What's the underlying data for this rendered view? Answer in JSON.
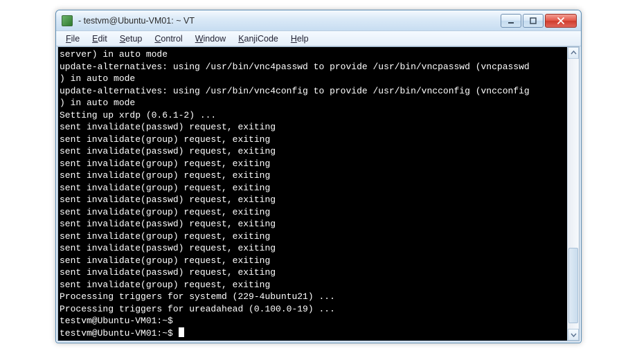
{
  "window": {
    "title": " - testvm@Ubuntu-VM01: ~ VT"
  },
  "menu": {
    "items": [
      {
        "u": "F",
        "rest": "ile"
      },
      {
        "u": "E",
        "rest": "dit"
      },
      {
        "u": "S",
        "rest": "etup"
      },
      {
        "u": "C",
        "rest": "ontrol"
      },
      {
        "u": "W",
        "rest": "indow"
      },
      {
        "u": "K",
        "rest": "anjiCode"
      },
      {
        "u": "H",
        "rest": "elp"
      }
    ]
  },
  "terminal": {
    "lines": [
      "server) in auto mode",
      "update-alternatives: using /usr/bin/vnc4passwd to provide /usr/bin/vncpasswd (vncpasswd",
      ") in auto mode",
      "update-alternatives: using /usr/bin/vnc4config to provide /usr/bin/vncconfig (vncconfig",
      ") in auto mode",
      "Setting up xrdp (0.6.1-2) ...",
      "sent invalidate(passwd) request, exiting",
      "sent invalidate(group) request, exiting",
      "sent invalidate(passwd) request, exiting",
      "sent invalidate(group) request, exiting",
      "sent invalidate(group) request, exiting",
      "sent invalidate(group) request, exiting",
      "sent invalidate(passwd) request, exiting",
      "sent invalidate(group) request, exiting",
      "sent invalidate(passwd) request, exiting",
      "sent invalidate(group) request, exiting",
      "sent invalidate(passwd) request, exiting",
      "sent invalidate(group) request, exiting",
      "sent invalidate(passwd) request, exiting",
      "sent invalidate(group) request, exiting",
      "Processing triggers for systemd (229-4ubuntu21) ...",
      "Processing triggers for ureadahead (0.100.0-19) ...",
      "testvm@Ubuntu-VM01:~$"
    ],
    "prompt": "testvm@Ubuntu-VM01:~$ "
  }
}
